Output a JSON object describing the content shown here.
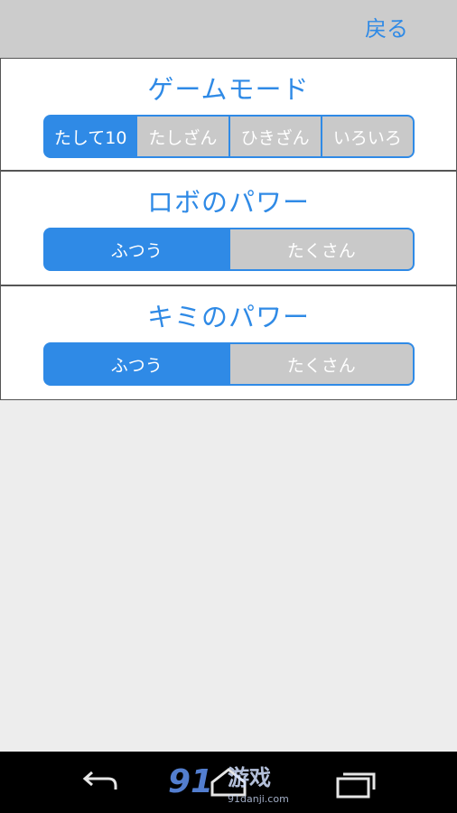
{
  "header": {
    "back_label": "戻る"
  },
  "sections": [
    {
      "title": "ゲームモード",
      "options": [
        "たして10",
        "たしざん",
        "ひきざん",
        "いろいろ"
      ],
      "selected_index": 0
    },
    {
      "title": "ロボのパワー",
      "options": [
        "ふつう",
        "たくさん"
      ],
      "selected_index": 0
    },
    {
      "title": "キミのパワー",
      "options": [
        "ふつう",
        "たくさん"
      ],
      "selected_index": 0
    }
  ],
  "watermark": {
    "number": "91",
    "name": "游戏",
    "domain": "91danji.com"
  },
  "navigation": {
    "icons": [
      "back-icon",
      "home-icon",
      "recent-apps-icon"
    ]
  },
  "colors": {
    "accent": "#2f8ae6",
    "unselected_segment": "#c9c9c9",
    "top_bar": "#cccccc",
    "background": "#ededed"
  }
}
